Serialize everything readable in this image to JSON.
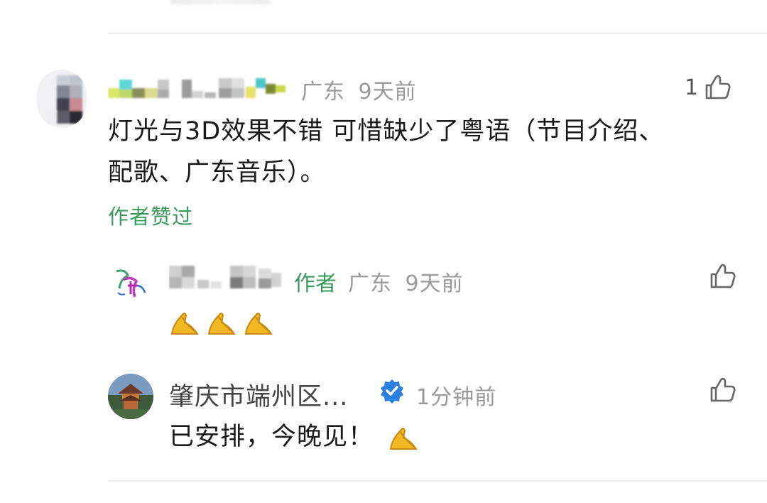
{
  "comment1": {
    "location": "广东",
    "time": "9天前",
    "like_count": "1",
    "text_line1": "灯光与3D效果不错 可惜缺少了粤语（节目介绍、",
    "text_line2": "配歌、广东音乐）。",
    "liked_by_author": "作者赞过"
  },
  "reply1": {
    "author_tag": "作者",
    "location": "广东",
    "time": "9天前",
    "emoji": "pray-hands x3"
  },
  "reply2": {
    "name": "肇庆市端州区...",
    "verified": "verified-badge",
    "time": "1分钟前",
    "text": "已安排，今晚见！",
    "emoji": "pray-hands"
  },
  "colors": {
    "green": "#3a9a5c",
    "meta_gray": "#9a9a9a",
    "verified_blue": "#2b7fe0",
    "emoji_gold": "#f2b824"
  },
  "icons": {
    "like": "thumbs-up-icon"
  }
}
